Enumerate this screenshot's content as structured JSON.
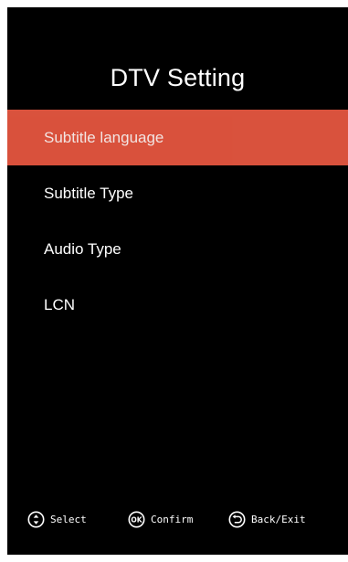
{
  "screen": {
    "title": "DTV Setting"
  },
  "menu": {
    "items": [
      {
        "label": "Subtitle language",
        "selected": true
      },
      {
        "label": "Subtitle Type",
        "selected": false
      },
      {
        "label": "Audio Type",
        "selected": false
      },
      {
        "label": "LCN",
        "selected": false
      }
    ]
  },
  "footer": {
    "select_label": "Select",
    "select_icon": "up-down-icon",
    "confirm_label": "Confirm",
    "confirm_icon": "ok-icon",
    "confirm_icon_text": "OK",
    "back_label": "Back/Exit",
    "back_icon": "back-icon"
  },
  "colors": {
    "background": "#000000",
    "highlight": "#e2553f",
    "text": "#ffffff"
  }
}
